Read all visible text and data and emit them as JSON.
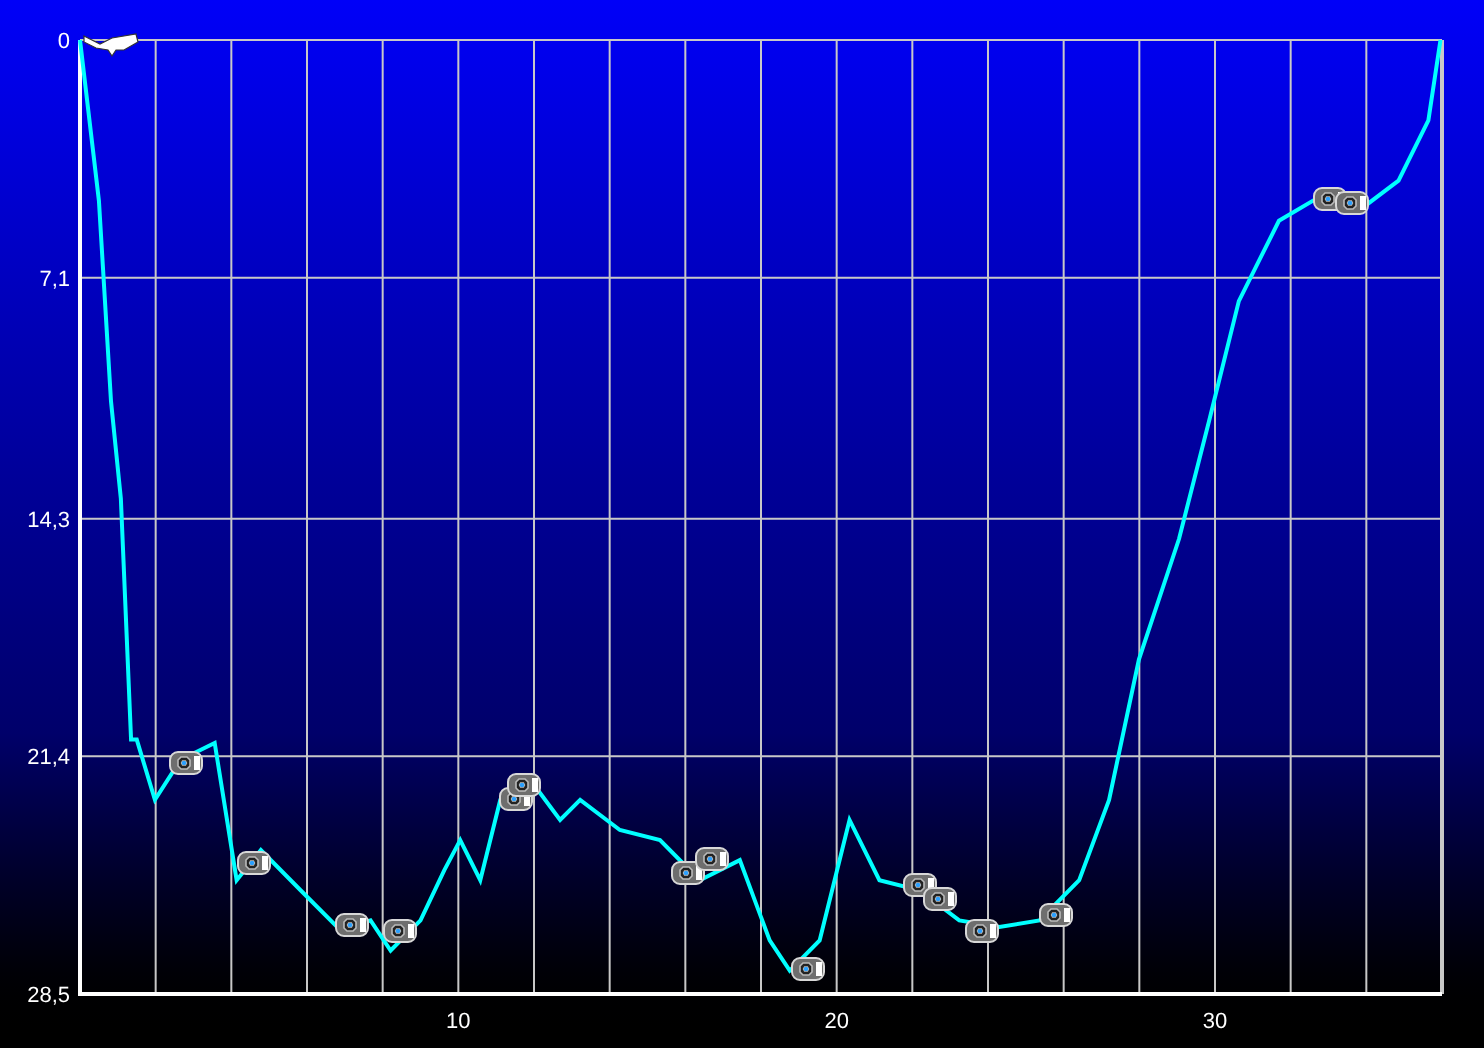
{
  "chart_data": {
    "type": "line",
    "grid": true,
    "xlim": [
      0,
      36
    ],
    "ylim": [
      28.5,
      0
    ],
    "xticks": [
      10,
      20,
      30
    ],
    "yticks": [
      {
        "value": 0,
        "label": "0"
      },
      {
        "value": 7.1,
        "label": "7,1"
      },
      {
        "value": 14.3,
        "label": "14,3"
      },
      {
        "value": 21.4,
        "label": "21,4"
      },
      {
        "value": 28.5,
        "label": "28,5"
      }
    ],
    "x": [
      0,
      0.5,
      0.82,
      1.08,
      1.35,
      1.5,
      1.98,
      2.66,
      3.56,
      4.14,
      4.78,
      5.83,
      6.89,
      7.68,
      8.21,
      9.0,
      9.63,
      10.05,
      10.58,
      11.11,
      11.9,
      12.69,
      13.22,
      14.27,
      15.33,
      16.38,
      17.44,
      18.23,
      18.76,
      19.55,
      20.34,
      21.13,
      22.19,
      23.24,
      24.3,
      25.36,
      26.41,
      27.2,
      27.99,
      29.05,
      29.84,
      30.63,
      31.69,
      32.74,
      33.8,
      34.85,
      35.64,
      35.96
    ],
    "series": [
      {
        "color": "#00ffff",
        "values": [
          0,
          4.8,
          10.8,
          13.7,
          20.9,
          20.9,
          22.7,
          21.5,
          21.0,
          25.1,
          24.2,
          25.4,
          26.6,
          26.3,
          27.2,
          26.3,
          24.8,
          23.9,
          25.1,
          22.7,
          22.1,
          23.3,
          22.7,
          23.6,
          23.9,
          25.1,
          24.5,
          26.9,
          27.8,
          26.9,
          23.3,
          25.1,
          25.4,
          26.3,
          26.5,
          26.3,
          25.1,
          22.7,
          18.5,
          14.9,
          11.4,
          7.8,
          5.4,
          4.7,
          5.1,
          4.2,
          2.4,
          0
        ]
      }
    ]
  }
}
